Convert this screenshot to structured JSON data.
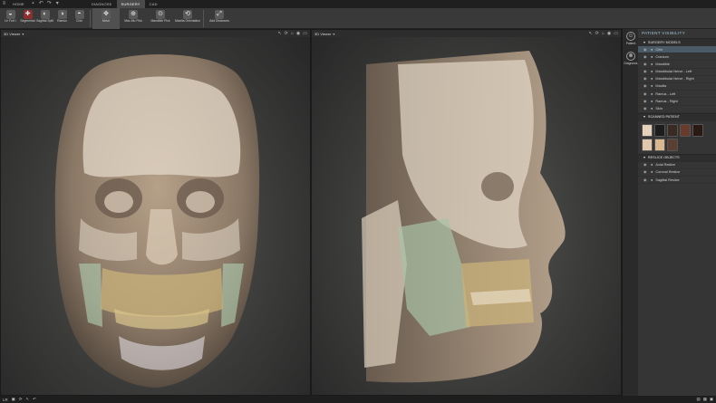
{
  "topbar": {
    "tabs": [
      {
        "label": "HOME",
        "active": false
      },
      {
        "label": "DIAGNOSE",
        "active": false
      },
      {
        "label": "SURGERY",
        "active": true
      },
      {
        "label": "CAD",
        "active": false
      }
    ]
  },
  "ribbon": {
    "buttons": [
      {
        "label": "Le Fort I",
        "icon": "lefort-icon"
      },
      {
        "label": "Segmental",
        "icon": "segmental-icon"
      },
      {
        "label": "Sagittal Split",
        "icon": "sagittal-icon"
      },
      {
        "label": "Ramus",
        "icon": "ramus-icon"
      },
      {
        "label": "Chin",
        "icon": "chin-icon"
      },
      {
        "label": "Move",
        "icon": "move-icon"
      },
      {
        "label": "Max-Mu Pick",
        "icon": "pick-icon"
      },
      {
        "label": "Mandible Pick",
        "icon": "mandible-pick-icon"
      },
      {
        "label": "Maxilla Orientation",
        "icon": "orientation-icon"
      },
      {
        "label": "Add Distances",
        "icon": "distance-icon"
      }
    ]
  },
  "viewers": {
    "left": {
      "title": "3D Viewer"
    },
    "right": {
      "title": "3D Viewer"
    }
  },
  "sidenav": {
    "items": [
      {
        "label": "Patient"
      },
      {
        "label": "Diagnosis"
      }
    ]
  },
  "panel": {
    "title": "PATIENT VISIBILITY",
    "surgery_models_label": "SURGERY MODELS",
    "surgery_models": [
      {
        "label": "Chin",
        "selected": true
      },
      {
        "label": "Cranium",
        "selected": false
      },
      {
        "label": "Mandible",
        "selected": false
      },
      {
        "label": "Mandibular Nerve - Left",
        "selected": false
      },
      {
        "label": "Mandibular Nerve - Right",
        "selected": false
      },
      {
        "label": "Maxilla",
        "selected": false
      },
      {
        "label": "Ramus - Left",
        "selected": false
      },
      {
        "label": "Ramus - Right",
        "selected": false
      },
      {
        "label": "Skin",
        "selected": false
      }
    ],
    "scanned_label": "SCANNED PATIENT",
    "scanned_thumb_colors": [
      "#e6d2b8",
      "#1c1c1c",
      "#3a2a24",
      "#6a3a2a",
      "#2a1a14",
      "#e0c8ac",
      "#d9b88f",
      "#5a4030"
    ],
    "reslice_label": "RESLICE OBJECTS",
    "reslice_objects": [
      {
        "label": "Axial Reslice"
      },
      {
        "label": "Coronal Reslice"
      },
      {
        "label": "Sagittal Reslice"
      }
    ]
  },
  "statusbar": {
    "left_label": "LR"
  },
  "colors": {
    "skin": "#a08d7a",
    "bone": "#e4d8c8",
    "teeth_region": "#c9b27a",
    "ramus_green": "#a9c2a6",
    "accent": "#9fc3d8"
  }
}
